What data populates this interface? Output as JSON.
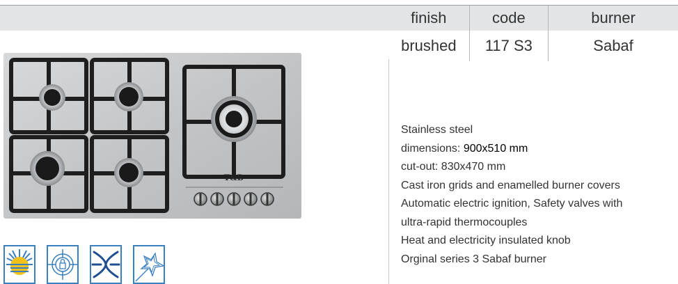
{
  "spec_table": {
    "headers": [
      "finish",
      "code",
      "burner"
    ],
    "row": [
      "brushed",
      "117 S3",
      "Sabaf"
    ]
  },
  "product": {
    "brand_logo": "T&D",
    "knob_count": 5,
    "burner_count": 5,
    "colors": {
      "steel": "#c9cbcd",
      "grid": "#1e1e1e",
      "icon_border": "#3a7fc0",
      "header_bg": "#e3e5e7"
    }
  },
  "description": {
    "line1": "Stainless steel",
    "dimensions_label": "dimensions: ",
    "dimensions_value": "900x510 mm",
    "line3": "cut-out: 830x470 mm",
    "line4": "Cast iron grids and enamelled burner covers",
    "line5": "Automatic electric ignition, Safety valves with",
    "line6": "ultra-rapid thermocouples",
    "line7": "Heat and electricity insulated knob",
    "line8": "Orginal series 3 Sabaf burner"
  },
  "feature_icons": [
    "sun-icon",
    "target-lock-icon",
    "fan-icon",
    "star-icon"
  ]
}
